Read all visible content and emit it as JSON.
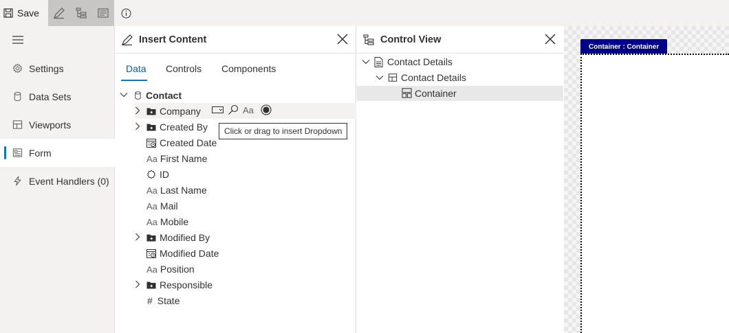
{
  "toolbar": {
    "save_label": "Save"
  },
  "nav": {
    "items": [
      {
        "label": "Settings",
        "icon": "gear-icon"
      },
      {
        "label": "Data Sets",
        "icon": "database-icon"
      },
      {
        "label": "Viewports",
        "icon": "layout-icon"
      },
      {
        "label": "Form",
        "icon": "form-icon",
        "active": true
      },
      {
        "label": "Event Handlers (0)",
        "icon": "lightning-icon"
      }
    ]
  },
  "insert_panel": {
    "title": "Insert Content",
    "tabs": [
      "Data",
      "Controls",
      "Components"
    ],
    "active_tab": "Data",
    "root": "Contact",
    "fields": [
      {
        "label": "Company",
        "type": "lookup",
        "expandable": true
      },
      {
        "label": "Created By",
        "type": "lookup",
        "expandable": true
      },
      {
        "label": "Created Date",
        "type": "date"
      },
      {
        "label": "First Name",
        "type": "text"
      },
      {
        "label": "ID",
        "type": "id"
      },
      {
        "label": "Last Name",
        "type": "text"
      },
      {
        "label": "Mail",
        "type": "text"
      },
      {
        "label": "Mobile",
        "type": "text"
      },
      {
        "label": "Modified By",
        "type": "lookup",
        "expandable": true
      },
      {
        "label": "Modified Date",
        "type": "date"
      },
      {
        "label": "Position",
        "type": "text"
      },
      {
        "label": "Responsible",
        "type": "lookup",
        "expandable": true
      },
      {
        "label": "State",
        "type": "number"
      }
    ],
    "text_type_glyph": "Aa",
    "number_type_glyph": "#",
    "row_tools_text_glyph": "Aa",
    "tooltip": "Click or drag to insert Dropdown"
  },
  "control_view": {
    "title": "Control View",
    "tree": [
      {
        "label": "Contact Details",
        "level": 0
      },
      {
        "label": "Contact Details",
        "level": 1
      },
      {
        "label": "Container",
        "level": 2,
        "selected": true
      }
    ]
  },
  "canvas": {
    "container_tag": "Container : Container"
  },
  "colors": {
    "accent": "#0078d4",
    "container_tag_bg": "#00008b"
  }
}
